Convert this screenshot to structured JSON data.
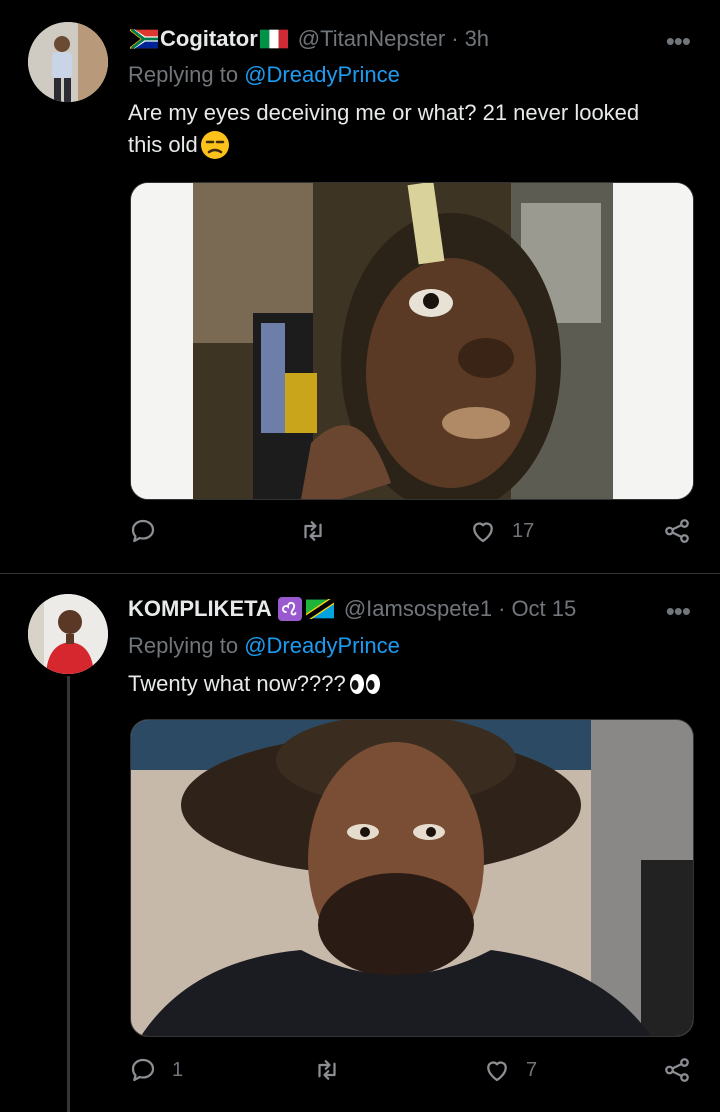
{
  "tweets": [
    {
      "display_name": "Cogitator",
      "handle": "@TitanNepster",
      "separator": "·",
      "time": "3h",
      "replying_prefix": "Replying to",
      "replying_to": "@DreadyPrince",
      "text_line1": "Are my eyes deceiving me or what? 21 never looked",
      "text_line2": "this old",
      "replies": "",
      "retweets": "",
      "likes": "17"
    },
    {
      "display_name": "KOMPLIKETA",
      "handle": "@Iamsospete1",
      "separator": "·",
      "time": "Oct 15",
      "replying_prefix": "Replying to",
      "replying_to": "@DreadyPrince",
      "text_line1": "Twenty what now????",
      "replies": "1",
      "retweets": "",
      "likes": "7"
    }
  ],
  "more_glyph": "•••",
  "icons": [
    "reply-icon",
    "retweet-icon",
    "like-icon",
    "share-icon"
  ],
  "colors": {
    "background": "#000000",
    "mention": "#1d9bf0",
    "muted": "#71767b",
    "text": "#e7e9ea"
  }
}
